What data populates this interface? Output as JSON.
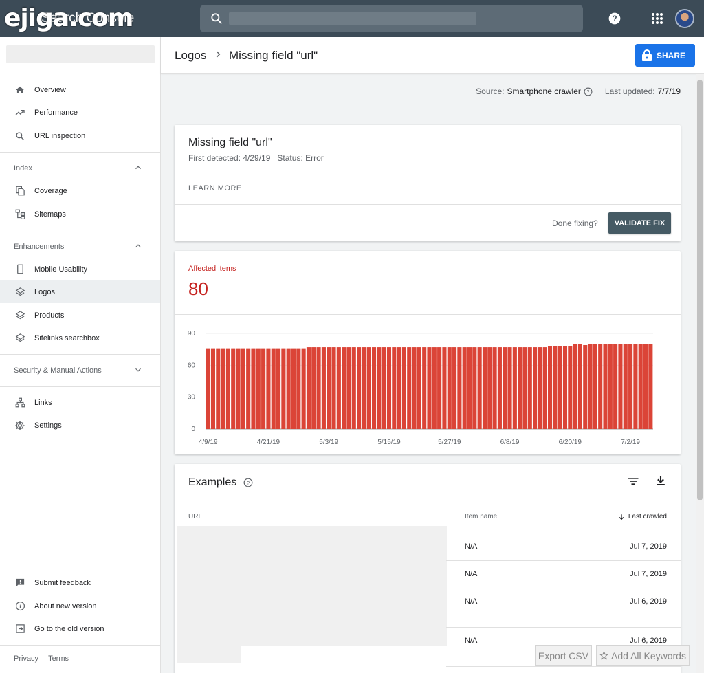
{
  "watermark": "ejiga.com",
  "app_title": "Search Console",
  "search": {
    "placeholder": ""
  },
  "sidebar": {
    "top_items": [
      {
        "label": "Overview",
        "icon": "home-icon"
      },
      {
        "label": "Performance",
        "icon": "trending-up-icon"
      },
      {
        "label": "URL inspection",
        "icon": "search-icon"
      }
    ],
    "index": {
      "heading": "Index",
      "items": [
        {
          "label": "Coverage",
          "icon": "file-copy-icon"
        },
        {
          "label": "Sitemaps",
          "icon": "sitemap-icon"
        }
      ]
    },
    "enhancements": {
      "heading": "Enhancements",
      "items": [
        {
          "label": "Mobile Usability",
          "icon": "phone-icon"
        },
        {
          "label": "Logos",
          "icon": "layers-icon",
          "active": true
        },
        {
          "label": "Products",
          "icon": "layers-icon"
        },
        {
          "label": "Sitelinks searchbox",
          "icon": "layers-icon"
        }
      ]
    },
    "security": {
      "heading": "Security & Manual Actions"
    },
    "other_items": [
      {
        "label": "Links",
        "icon": "links-icon"
      },
      {
        "label": "Settings",
        "icon": "gear-icon"
      }
    ],
    "bottom_items": [
      {
        "label": "Submit feedback",
        "icon": "feedback-icon"
      },
      {
        "label": "About new version",
        "icon": "info-icon"
      },
      {
        "label": "Go to the old version",
        "icon": "exit-icon"
      }
    ],
    "footer": {
      "privacy": "Privacy",
      "terms": "Terms"
    }
  },
  "header": {
    "breadcrumb_parent": "Logos",
    "breadcrumb_current": "Missing field \"url\"",
    "share_label": "SHARE"
  },
  "meta": {
    "source_label": "Source:",
    "source_value": "Smartphone crawler",
    "updated_label": "Last updated:",
    "updated_value": "7/7/19"
  },
  "issue": {
    "title": "Missing field \"url\"",
    "subtitle": "First detected: 4/29/19   Status: Error",
    "learn_more": "LEARN MORE",
    "done_fixing": "Done fixing?",
    "validate_label": "VALIDATE FIX"
  },
  "affected": {
    "label": "Affected items",
    "value": "80"
  },
  "chart_data": {
    "type": "bar",
    "color": "#db4437",
    "ylim": [
      0,
      90
    ],
    "yticks": [
      0,
      30,
      60,
      90
    ],
    "xticks": [
      "4/9/19",
      "4/21/19",
      "5/3/19",
      "5/15/19",
      "5/27/19",
      "6/8/19",
      "6/20/19",
      "7/2/19"
    ],
    "start_date": "4/9/19",
    "values": [
      76,
      76,
      76,
      76,
      76,
      76,
      76,
      76,
      76,
      76,
      76,
      76,
      76,
      76,
      76,
      76,
      76,
      76,
      76,
      76,
      77,
      77,
      77,
      77,
      77,
      77,
      77,
      77,
      77,
      77,
      77,
      77,
      77,
      77,
      77,
      77,
      77,
      77,
      77,
      77,
      77,
      77,
      77,
      77,
      77,
      77,
      77,
      77,
      77,
      77,
      77,
      77,
      77,
      77,
      77,
      77,
      77,
      77,
      77,
      77,
      77,
      77,
      77,
      77,
      77,
      77,
      77,
      77,
      78,
      78,
      78,
      78,
      78,
      80,
      80,
      79,
      80,
      80,
      80,
      80,
      80,
      80,
      80,
      80,
      80,
      80,
      80,
      80,
      80
    ]
  },
  "examples": {
    "title": "Examples",
    "columns": {
      "url": "URL",
      "item": "Item name",
      "crawled": "Last crawled"
    },
    "rows": [
      {
        "item": "N/A",
        "date": "Jul 7, 2019"
      },
      {
        "item": "N/A",
        "date": "Jul 7, 2019"
      },
      {
        "item": "N/A",
        "date": "Jul 6, 2019"
      },
      {
        "item": "N/A",
        "date": "Jul 6, 2019"
      }
    ]
  },
  "overlay": {
    "export_label": "Export CSV",
    "keywords_label": "Add All Keywords"
  }
}
